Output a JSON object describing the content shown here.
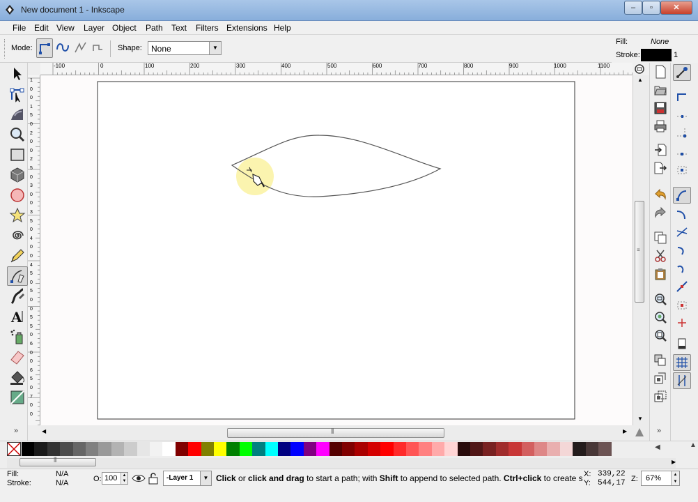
{
  "window": {
    "title": "New document 1 - Inkscape",
    "buttons": [
      "–",
      "▫",
      "✕"
    ]
  },
  "menu": [
    "File",
    "Edit",
    "View",
    "Layer",
    "Object",
    "Path",
    "Text",
    "Filters",
    "Extensions",
    "Help"
  ],
  "tool_controls": {
    "mode_label": "Mode:",
    "shape_label": "Shape:",
    "shape_value": "None"
  },
  "style_indicator": {
    "fill_label": "Fill:",
    "fill_value": "None",
    "stroke_label": "Stroke:",
    "stroke_width": "1",
    "stroke_color": "#000000"
  },
  "ruler_h_labels": [
    "-100",
    "0",
    "100",
    "200",
    "300",
    "400",
    "500",
    "600",
    "700",
    "800",
    "900",
    "1000",
    "1100"
  ],
  "ruler_v_labels": [
    "1",
    "0",
    "0",
    "1",
    "5",
    "0",
    "2",
    "0",
    "0",
    "2",
    "5",
    "0",
    "3",
    "0",
    "0",
    "3",
    "5",
    "0",
    "4",
    "0",
    "0",
    "4",
    "5",
    "0",
    "5",
    "0",
    "0",
    "5",
    "5",
    "0",
    "6",
    "0",
    "0",
    "6",
    "5",
    "0",
    "7",
    "0",
    "0"
  ],
  "palette": {
    "colors": [
      "#000000",
      "#1a1a1a",
      "#333333",
      "#4d4d4d",
      "#666666",
      "#808080",
      "#999999",
      "#b3b3b3",
      "#cccccc",
      "#e6e6e6",
      "#f2f2f2",
      "#ffffff",
      "#800000",
      "#ff0000",
      "#808000",
      "#ffff00",
      "#008000",
      "#00ff00",
      "#008080",
      "#00ffff",
      "#000080",
      "#0000ff",
      "#800080",
      "#ff00ff",
      "#550000",
      "#800000",
      "#aa0000",
      "#d40000",
      "#ff0000",
      "#ff2a2a",
      "#ff5555",
      "#ff8080",
      "#ffaaaa",
      "#ffd5d5",
      "#280b0b",
      "#501616",
      "#782121",
      "#a02c2c",
      "#c83737",
      "#d35f5f",
      "#de8787",
      "#e9afaf",
      "#f4d7d7",
      "#241c1c",
      "#483737",
      "#6c5353"
    ]
  },
  "status": {
    "fill_label": "Fill:",
    "fill_value": "N/A",
    "stroke_label": "Stroke:",
    "stroke_value": "N/A",
    "opacity_label": "O:",
    "opacity_value": "100",
    "layer": "-Layer 1",
    "message_b1": "Click",
    "message_t1": " or ",
    "message_b2": "click and drag",
    "message_t2": " to start a path; with ",
    "message_b3": "Shift",
    "message_t3": " to append to selected path. ",
    "message_b4": "Ctrl+click",
    "message_t4": " to create singl",
    "x_label": "X:",
    "x_value": "339,22",
    "y_label": "Y:",
    "y_value": "544,17",
    "zoom_label": "Z:",
    "zoom_value": "67%"
  },
  "icons": {
    "toolbox": [
      "selector-arrow-icon",
      "node-editor-icon",
      "tweak-icon",
      "zoom-icon",
      "rectangle-icon",
      "box-3d-icon",
      "ellipse-icon",
      "star-icon",
      "spiral-icon",
      "pencil-icon",
      "bezier-pen-icon",
      "calligraphy-icon",
      "text-icon",
      "spray-icon",
      "eraser-icon",
      "paint-bucket-icon",
      "gradient-icon"
    ],
    "commands": [
      "new-document-icon",
      "open-icon",
      "save-icon",
      "print-icon",
      "import-icon",
      "export-icon",
      "undo-icon",
      "redo-icon",
      "copy-icon",
      "cut-icon",
      "paste-icon",
      "zoom-selection-icon",
      "zoom-drawing-icon",
      "zoom-page-icon",
      "duplicate-icon",
      "clone-icon",
      "unlink-clone-icon"
    ]
  }
}
